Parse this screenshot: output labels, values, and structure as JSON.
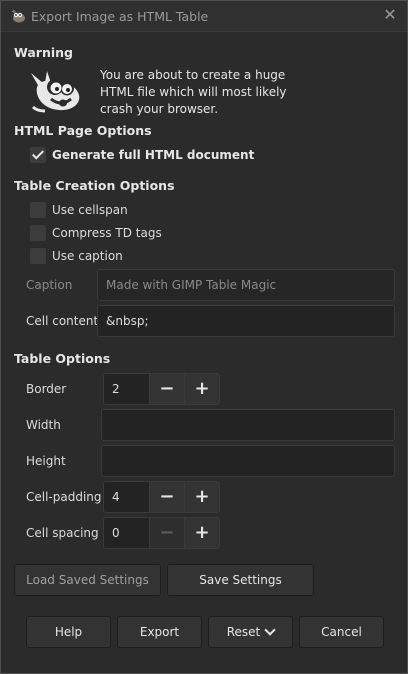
{
  "window": {
    "title": "Export Image as HTML Table"
  },
  "warning": {
    "heading": "Warning",
    "message": "You are about to create a huge HTML file which will most likely crash your browser."
  },
  "page_options": {
    "heading": "HTML Page Options",
    "generate_full": {
      "label": "Generate full HTML document",
      "checked": true
    }
  },
  "table_creation": {
    "heading": "Table Creation Options",
    "use_cellspan": {
      "label": "Use cellspan",
      "checked": false
    },
    "compress_td": {
      "label": "Compress TD tags",
      "checked": false
    },
    "use_caption": {
      "label": "Use caption",
      "checked": false
    },
    "caption": {
      "label": "Caption",
      "value": "Made with GIMP Table Magic"
    },
    "cell_content": {
      "label": "Cell content",
      "value": "&nbsp;"
    }
  },
  "table_options": {
    "heading": "Table Options",
    "border": {
      "label": "Border",
      "value": "2"
    },
    "width": {
      "label": "Width",
      "value": ""
    },
    "height": {
      "label": "Height",
      "value": ""
    },
    "cell_padding": {
      "label": "Cell-padding",
      "value": "4"
    },
    "cell_spacing": {
      "label": "Cell spacing",
      "value": "0"
    }
  },
  "settings": {
    "load_label": "Load Saved Settings",
    "save_label": "Save Settings"
  },
  "actions": {
    "help": "Help",
    "export": "Export",
    "reset": "Reset",
    "cancel": "Cancel"
  },
  "icons": {
    "app": "gimp-wilber-icon",
    "close": "close-icon",
    "mascot": "wilber-mascot-icon",
    "minus": "minus-icon",
    "plus": "plus-icon",
    "chevron": "chevron-down-icon"
  }
}
